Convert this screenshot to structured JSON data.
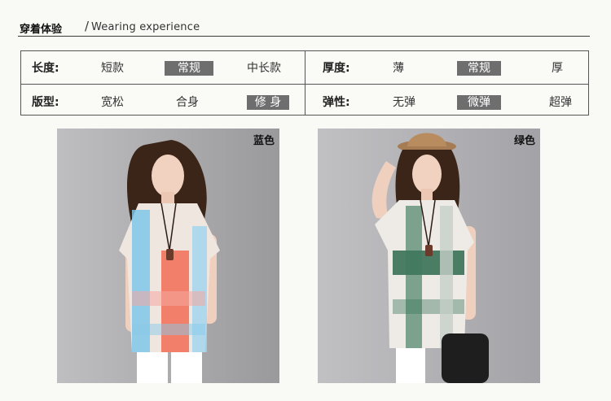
{
  "header": {
    "title_zh": "穿着体验",
    "separator": "/",
    "title_en": "Wearing experience"
  },
  "spec": {
    "length": {
      "label": "长度:",
      "options": [
        "短款",
        "常规",
        "中长款"
      ],
      "selected": "常规"
    },
    "thickness": {
      "label": "厚度:",
      "options": [
        "薄",
        "常规",
        "厚"
      ],
      "selected": "常规"
    },
    "fit": {
      "label": "版型:",
      "options": [
        "宽松",
        "合身",
        "修 身"
      ],
      "selected": "修 身"
    },
    "elasticity": {
      "label": "弹性:",
      "options": [
        "无弹",
        "微弹",
        "超弹"
      ],
      "selected": "微弹"
    },
    "selected_color": "#6e6e6e"
  },
  "photos": [
    {
      "color_label": "蓝色",
      "background": "#a9a8ab"
    },
    {
      "color_label": "绿色",
      "background": "#b1b0b4"
    }
  ]
}
